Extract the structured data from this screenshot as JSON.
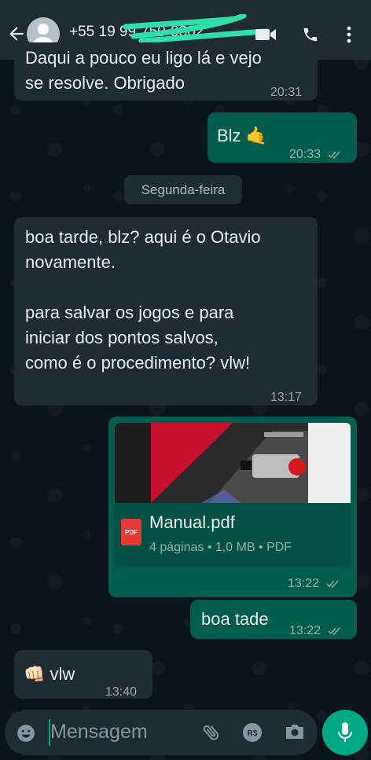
{
  "header": {
    "contact_number": "+55 19 99",
    "contact_number_hidden": "750-9302"
  },
  "messages": [
    {
      "type": "incoming",
      "text": "Daqui a pouco eu ligo lá e vejo\nse resolve. Obrigado",
      "time": "20:31"
    },
    {
      "type": "outgoing",
      "text": "Blz 🤙",
      "time": "20:33"
    },
    {
      "type": "date",
      "text": "Segunda-feira"
    },
    {
      "type": "incoming",
      "text": "boa tarde, blz? aqui é o Otavio\nnovamente.\n\npara salvar os jogos e para\niniciar dos pontos salvos,\ncomo é o procedimento? vlw!",
      "time": "13:17"
    },
    {
      "type": "document",
      "filename": "Manual.pdf",
      "badge": "PDF",
      "meta": "4 páginas • 1,0 MB • PDF",
      "time": "13:22"
    },
    {
      "type": "outgoing",
      "text": "boa tade",
      "time": "13:22"
    },
    {
      "type": "incoming",
      "text": "👊🏻 vlw",
      "time": "13:40"
    }
  ],
  "input": {
    "placeholder": "Mensagem"
  },
  "colors": {
    "header_bg": "#1f2c34",
    "incoming_bg": "#1f2c34",
    "outgoing_bg": "#005c4b",
    "accent": "#00a884",
    "background": "#0b141a"
  },
  "icons": [
    "back-arrow-icon",
    "avatar-icon",
    "video-call-icon",
    "phone-icon",
    "more-options-icon",
    "emoji-icon",
    "attach-icon",
    "payment-icon",
    "camera-icon",
    "mic-icon",
    "read-receipt-icon",
    "pdf-icon"
  ]
}
